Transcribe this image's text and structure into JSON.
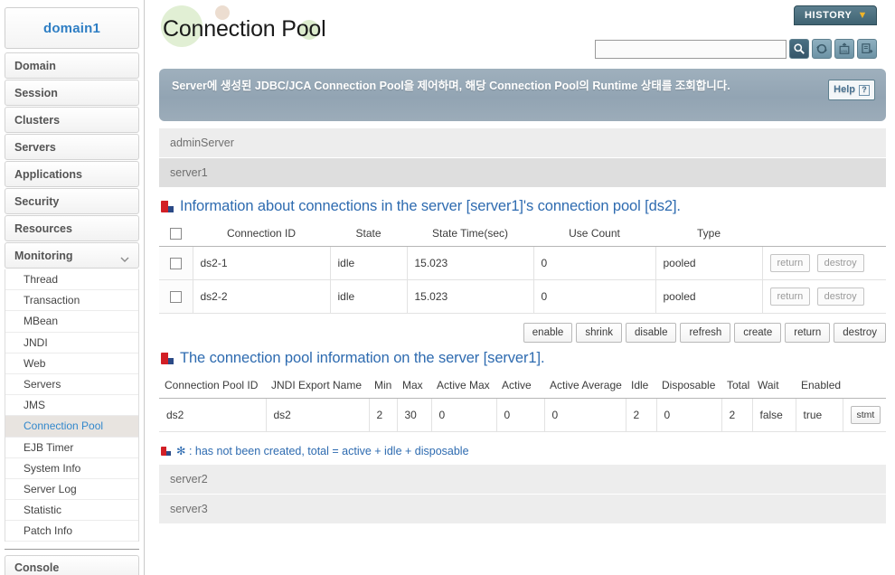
{
  "sidebar": {
    "domain_label": "domain1",
    "top_items": [
      {
        "label": "Domain"
      },
      {
        "label": "Session"
      },
      {
        "label": "Clusters"
      },
      {
        "label": "Servers"
      },
      {
        "label": "Applications"
      },
      {
        "label": "Security"
      },
      {
        "label": "Resources"
      },
      {
        "label": "Monitoring",
        "expanded": true
      }
    ],
    "sub_items": [
      {
        "label": "Thread"
      },
      {
        "label": "Transaction"
      },
      {
        "label": "MBean"
      },
      {
        "label": "JNDI"
      },
      {
        "label": "Web"
      },
      {
        "label": "Servers"
      },
      {
        "label": "JMS"
      },
      {
        "label": "Connection Pool",
        "active": true
      },
      {
        "label": "EJB Timer"
      },
      {
        "label": "System Info"
      },
      {
        "label": "Server Log"
      },
      {
        "label": "Statistic"
      },
      {
        "label": "Patch Info"
      }
    ],
    "console_label": "Console",
    "active_color": "#3388cc",
    "domain_color": "#2e7ec4"
  },
  "header": {
    "title": "Connection Pool",
    "history_label": "HISTORY",
    "history_caret": "▼",
    "search_value": "",
    "search_placeholder": "",
    "icons": [
      {
        "name": "search-icon",
        "active": true
      },
      {
        "name": "refresh-icon",
        "active": false
      },
      {
        "name": "xml-export-icon",
        "active": false
      },
      {
        "name": "excel-export-icon",
        "active": false
      }
    ]
  },
  "notice": {
    "text": "Server에 생성된 JDBC/JCA Connection Pool을 제어하며, 해당 Connection Pool의 Runtime 상태를 조회합니다.",
    "help_label": "Help",
    "help_glyph": "?"
  },
  "servers_top": [
    {
      "name": "adminServer",
      "tone": "light"
    },
    {
      "name": "server1",
      "tone": "dark"
    }
  ],
  "servers_bottom": [
    {
      "name": "server2",
      "tone": "light"
    },
    {
      "name": "server3",
      "tone": "light"
    }
  ],
  "connections_section": {
    "title": "Information about connections in the server [server1]'s connection pool [ds2].",
    "columns": [
      "",
      "Connection ID",
      "State",
      "State Time(sec)",
      "Use Count",
      "Type",
      ""
    ],
    "rows": [
      {
        "checked": false,
        "connection_id": "ds2-1",
        "state": "idle",
        "state_time": "15.023",
        "use_count": "0",
        "type": "pooled",
        "actions": [
          "return",
          "destroy"
        ]
      },
      {
        "checked": false,
        "connection_id": "ds2-2",
        "state": "idle",
        "state_time": "15.023",
        "use_count": "0",
        "type": "pooled",
        "actions": [
          "return",
          "destroy"
        ]
      }
    ]
  },
  "toolbar": {
    "buttons": [
      "enable",
      "shrink",
      "disable",
      "refresh",
      "create",
      "return",
      "destroy"
    ]
  },
  "pool_section": {
    "title": "The connection pool information on the server [server1].",
    "columns": [
      "Connection Pool ID",
      "JNDI Export Name",
      "Min",
      "Max",
      "Active Max",
      "Active",
      "Active Average",
      "Idle",
      "Disposable",
      "Total",
      "Wait",
      "Enabled",
      ""
    ],
    "rows": [
      {
        "pool_id": "ds2",
        "jndi_export_name": "ds2",
        "min": "2",
        "max": "30",
        "active_max": "0",
        "active": "0",
        "active_average": "0",
        "idle": "2",
        "disposable": "0",
        "total": "2",
        "wait": "false",
        "enabled": "true",
        "stmt_label": "stmt"
      }
    ]
  },
  "footnote": {
    "text": "✻ : has not been created, total = active + idle + disposable"
  }
}
